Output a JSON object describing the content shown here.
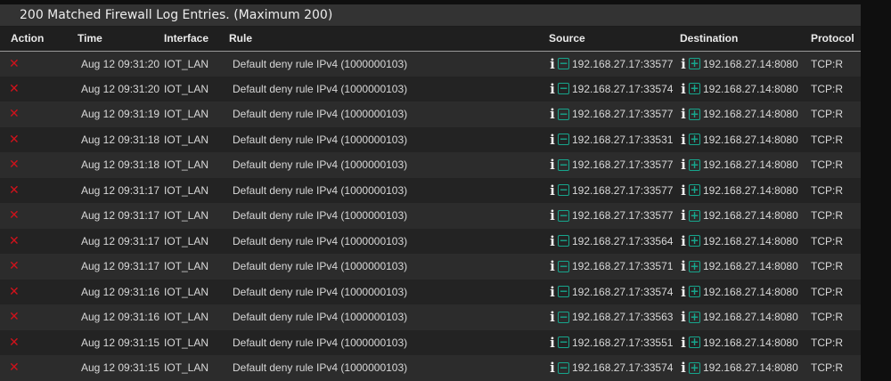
{
  "panel": {
    "title": "200 Matched Firewall Log Entries. (Maximum 200)"
  },
  "columns": {
    "action": "Action",
    "time": "Time",
    "interface": "Interface",
    "rule": "Rule",
    "source": "Source",
    "destination": "Destination",
    "protocol": "Protocol"
  },
  "icons": {
    "action": "block-x-icon",
    "info": "info-icon",
    "source_filter": "minus-box-icon",
    "destination_filter": "plus-box-icon"
  },
  "colors": {
    "block": "#d0121b",
    "filter_icon": "#17a58c"
  },
  "rows": [
    {
      "action": "✕",
      "time": "Aug 12 09:31:20",
      "interface": "IOT_LAN",
      "rule": "Default deny rule IPv4 (1000000103)",
      "source": "192.168.27.17:33577",
      "destination": "192.168.27.14:8080",
      "protocol": "TCP:R"
    },
    {
      "action": "✕",
      "time": "Aug 12 09:31:20",
      "interface": "IOT_LAN",
      "rule": "Default deny rule IPv4 (1000000103)",
      "source": "192.168.27.17:33574",
      "destination": "192.168.27.14:8080",
      "protocol": "TCP:R"
    },
    {
      "action": "✕",
      "time": "Aug 12 09:31:19",
      "interface": "IOT_LAN",
      "rule": "Default deny rule IPv4 (1000000103)",
      "source": "192.168.27.17:33577",
      "destination": "192.168.27.14:8080",
      "protocol": "TCP:R"
    },
    {
      "action": "✕",
      "time": "Aug 12 09:31:18",
      "interface": "IOT_LAN",
      "rule": "Default deny rule IPv4 (1000000103)",
      "source": "192.168.27.17:33531",
      "destination": "192.168.27.14:8080",
      "protocol": "TCP:R"
    },
    {
      "action": "✕",
      "time": "Aug 12 09:31:18",
      "interface": "IOT_LAN",
      "rule": "Default deny rule IPv4 (1000000103)",
      "source": "192.168.27.17:33577",
      "destination": "192.168.27.14:8080",
      "protocol": "TCP:R"
    },
    {
      "action": "✕",
      "time": "Aug 12 09:31:17",
      "interface": "IOT_LAN",
      "rule": "Default deny rule IPv4 (1000000103)",
      "source": "192.168.27.17:33577",
      "destination": "192.168.27.14:8080",
      "protocol": "TCP:R"
    },
    {
      "action": "✕",
      "time": "Aug 12 09:31:17",
      "interface": "IOT_LAN",
      "rule": "Default deny rule IPv4 (1000000103)",
      "source": "192.168.27.17:33577",
      "destination": "192.168.27.14:8080",
      "protocol": "TCP:R"
    },
    {
      "action": "✕",
      "time": "Aug 12 09:31:17",
      "interface": "IOT_LAN",
      "rule": "Default deny rule IPv4 (1000000103)",
      "source": "192.168.27.17:33564",
      "destination": "192.168.27.14:8080",
      "protocol": "TCP:R"
    },
    {
      "action": "✕",
      "time": "Aug 12 09:31:17",
      "interface": "IOT_LAN",
      "rule": "Default deny rule IPv4 (1000000103)",
      "source": "192.168.27.17:33571",
      "destination": "192.168.27.14:8080",
      "protocol": "TCP:R"
    },
    {
      "action": "✕",
      "time": "Aug 12 09:31:16",
      "interface": "IOT_LAN",
      "rule": "Default deny rule IPv4 (1000000103)",
      "source": "192.168.27.17:33574",
      "destination": "192.168.27.14:8080",
      "protocol": "TCP:R"
    },
    {
      "action": "✕",
      "time": "Aug 12 09:31:16",
      "interface": "IOT_LAN",
      "rule": "Default deny rule IPv4 (1000000103)",
      "source": "192.168.27.17:33563",
      "destination": "192.168.27.14:8080",
      "protocol": "TCP:R"
    },
    {
      "action": "✕",
      "time": "Aug 12 09:31:15",
      "interface": "IOT_LAN",
      "rule": "Default deny rule IPv4 (1000000103)",
      "source": "192.168.27.17:33551",
      "destination": "192.168.27.14:8080",
      "protocol": "TCP:R"
    },
    {
      "action": "✕",
      "time": "Aug 12 09:31:15",
      "interface": "IOT_LAN",
      "rule": "Default deny rule IPv4 (1000000103)",
      "source": "192.168.27.17:33574",
      "destination": "192.168.27.14:8080",
      "protocol": "TCP:R"
    }
  ]
}
